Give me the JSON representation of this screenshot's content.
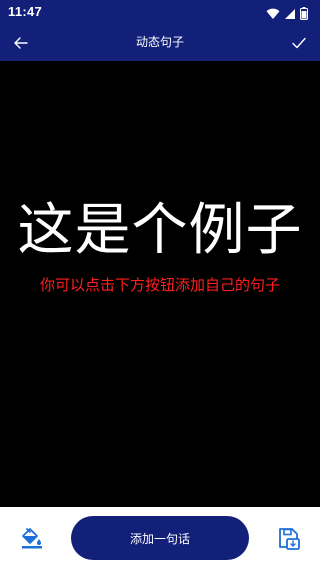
{
  "status": {
    "time": "11:47",
    "icons": [
      "wifi-icon",
      "signal-icon",
      "battery-icon"
    ]
  },
  "appbar": {
    "title": "动态句子",
    "back_icon": "back-arrow-icon",
    "confirm_icon": "check-icon"
  },
  "content": {
    "main_text": "这是个例子",
    "hint_text": "你可以点击下方按钮添加自己的句子"
  },
  "bottombar": {
    "fill_icon": "paint-bucket-icon",
    "add_label": "添加一句话",
    "save_icon": "save-icon"
  },
  "colors": {
    "primary": "#13207a",
    "hint": "#ff1f1f",
    "accent_icon": "#1e6fd9"
  }
}
